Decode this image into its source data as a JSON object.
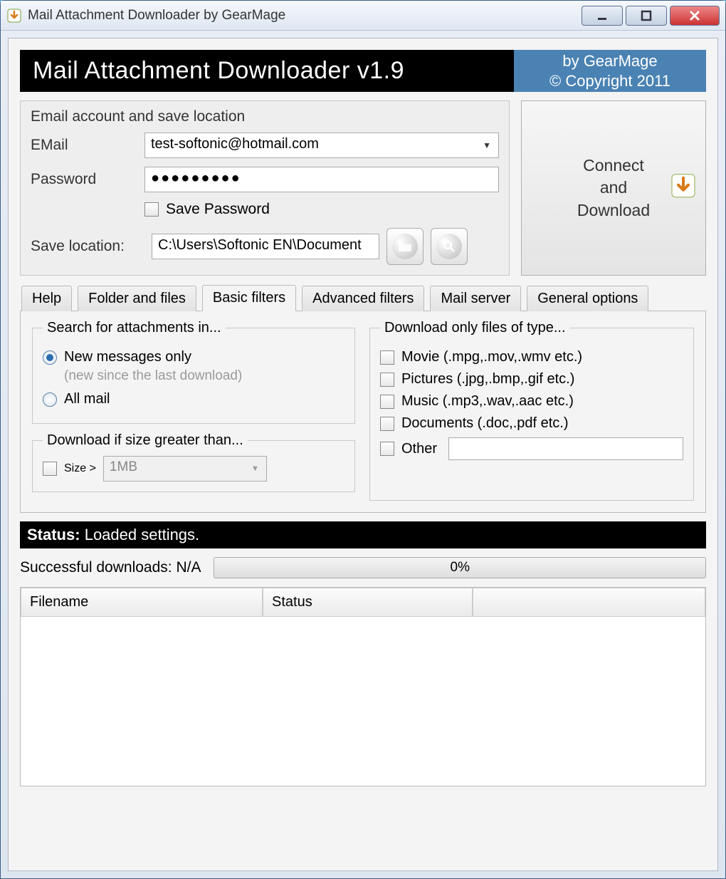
{
  "window": {
    "title": "Mail Attachment Downloader by GearMage"
  },
  "header": {
    "title": "Mail Attachment Downloader v1.9",
    "by": "by GearMage",
    "copyright": "© Copyright 2011"
  },
  "account": {
    "group_title": "Email account and save location",
    "email_label": "EMail",
    "email_value": "test-softonic@hotmail.com",
    "password_label": "Password",
    "password_value": "●●●●●●●●●",
    "save_password_label": "Save Password",
    "save_location_label": "Save location:",
    "save_location_value": "C:\\Users\\Softonic EN\\Document"
  },
  "connect": {
    "line1": "Connect",
    "line2": "and",
    "line3": "Download"
  },
  "tabs": {
    "items": [
      "Help",
      "Folder and files",
      "Basic filters",
      "Advanced filters",
      "Mail server",
      "General options"
    ],
    "active_index": 2
  },
  "filters": {
    "search_legend": "Search for attachments in...",
    "radio_new": "New messages only",
    "radio_new_hint": "(new since the last download)",
    "radio_all": "All mail",
    "size_legend": "Download if size greater than...",
    "size_checkbox": "Size >",
    "size_value": "1MB",
    "types_legend": "Download only files of type...",
    "type_movie": "Movie (.mpg,.mov,.wmv etc.)",
    "type_pictures": "Pictures (.jpg,.bmp,.gif etc.)",
    "type_music": "Music (.mp3,.wav,.aac etc.)",
    "type_docs": "Documents (.doc,.pdf etc.)",
    "type_other": "Other"
  },
  "status": {
    "label": "Status",
    "text": "Loaded settings."
  },
  "downloads": {
    "label": "Successful downloads:",
    "value": "N/A",
    "progress": "0%"
  },
  "table": {
    "col1": "Filename",
    "col2": "Status",
    "col3": ""
  }
}
